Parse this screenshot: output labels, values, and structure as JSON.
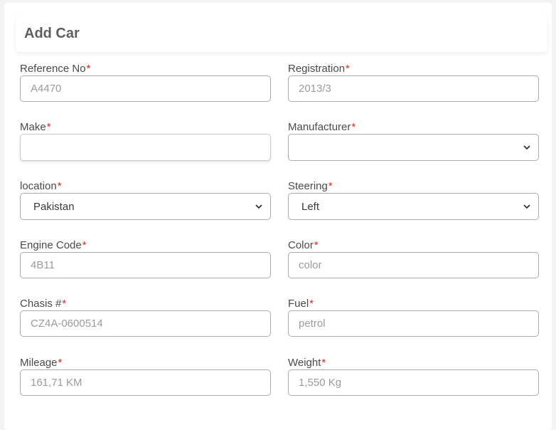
{
  "header": {
    "title": "Add Car"
  },
  "fields": {
    "reference_no": {
      "label": "Reference No",
      "required": "*",
      "placeholder": "A4470"
    },
    "registration": {
      "label": "Registration",
      "required": "*",
      "placeholder": "2013/3"
    },
    "make": {
      "label": "Make",
      "required": "*",
      "value": ""
    },
    "manufacturer": {
      "label": "Manufacturer",
      "required": "*",
      "selected": ""
    },
    "location": {
      "label": "location",
      "required": "*",
      "selected": "Pakistan"
    },
    "steering": {
      "label": "Steering",
      "required": "*",
      "selected": "Left"
    },
    "engine_code": {
      "label": "Engine Code",
      "required": "*",
      "placeholder": "4B11"
    },
    "color": {
      "label": "Color",
      "required": "*",
      "placeholder": "color"
    },
    "chasis": {
      "label": "Chasis #",
      "required": "*",
      "placeholder": "CZ4A-0600514"
    },
    "fuel": {
      "label": "Fuel",
      "required": "*",
      "placeholder": "petrol"
    },
    "mileage": {
      "label": "Mileage",
      "required": "*",
      "placeholder": "161,71 KM"
    },
    "weight": {
      "label": "Weight",
      "required": "*",
      "placeholder": "1,550 Kg"
    }
  },
  "icons": {
    "select_arrow": "chevron-down-icon"
  },
  "colors": {
    "required": "#e02424",
    "border": "#ababab"
  }
}
